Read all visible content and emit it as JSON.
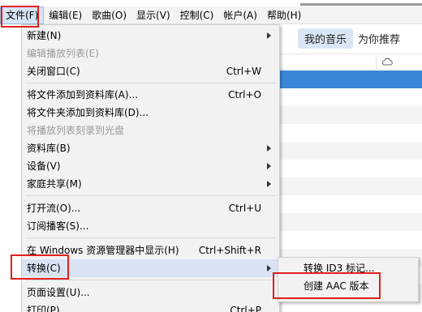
{
  "menubar": {
    "items": [
      "文件(F)",
      "编辑(E)",
      "歌曲(O)",
      "显示(V)",
      "控制(C)",
      "帐户(A)",
      "帮助(H)"
    ],
    "active_index": 0
  },
  "content": {
    "tabs": [
      "我的音乐",
      "为你推荐"
    ],
    "active_tab": "我的音乐",
    "cloud_icon": "cloud-icon",
    "highlight_color": "#3a86d9"
  },
  "file_menu": {
    "items": [
      {
        "label": "新建(N)",
        "shortcut": "",
        "submenu": true,
        "disabled": false
      },
      {
        "label": "编辑播放列表(E)",
        "shortcut": "",
        "submenu": false,
        "disabled": true
      },
      {
        "label": "关闭窗口(C)",
        "shortcut": "Ctrl+W",
        "submenu": false,
        "disabled": false
      },
      {
        "label": "将文件添加到资料库(A)...",
        "shortcut": "Ctrl+O",
        "submenu": false,
        "disabled": false
      },
      {
        "label": "将文件夹添加到资料库(D)...",
        "shortcut": "",
        "submenu": false,
        "disabled": false
      },
      {
        "label": "将播放列表刻录到光盘",
        "shortcut": "",
        "submenu": false,
        "disabled": true
      },
      {
        "label": "资料库(B)",
        "shortcut": "",
        "submenu": true,
        "disabled": false
      },
      {
        "label": "设备(V)",
        "shortcut": "",
        "submenu": true,
        "disabled": false
      },
      {
        "label": "家庭共享(M)",
        "shortcut": "",
        "submenu": true,
        "disabled": false
      },
      {
        "label": "打开流(O)...",
        "shortcut": "Ctrl+U",
        "submenu": false,
        "disabled": false
      },
      {
        "label": "订阅播客(S)...",
        "shortcut": "",
        "submenu": false,
        "disabled": false
      },
      {
        "label": "在 Windows 资源管理器中显示(H)",
        "shortcut": "Ctrl+Shift+R",
        "submenu": false,
        "disabled": false
      },
      {
        "label": "转换(C)",
        "shortcut": "",
        "submenu": true,
        "disabled": false
      },
      {
        "label": "页面设置(U)...",
        "shortcut": "",
        "submenu": false,
        "disabled": false
      },
      {
        "label": "打印(P)...",
        "shortcut": "Ctrl+P",
        "submenu": false,
        "disabled": false
      }
    ],
    "hovered_label": "转换(C)"
  },
  "convert_submenu": {
    "items": [
      "转换 ID3 标记...",
      "创建 AAC 版本"
    ]
  },
  "annotation_color": "#e0201a"
}
